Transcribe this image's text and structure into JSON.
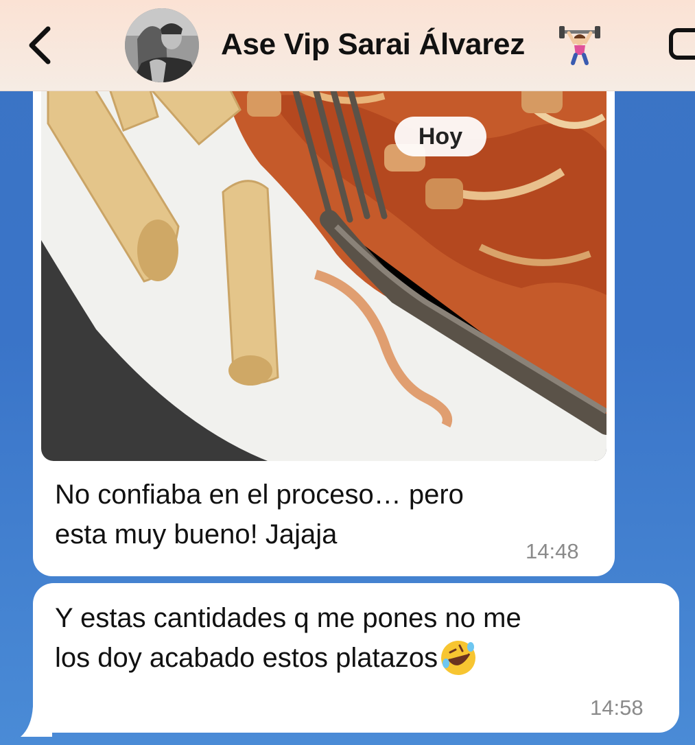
{
  "header": {
    "contact_name": "Ase Vip Sarai Álvarez",
    "status_emoji": "weightlifter-emoji",
    "back_icon": "chevron-left-icon",
    "avatar_icon": "contact-photo",
    "video_icon": "video-call-icon"
  },
  "date_separator": "Hoy",
  "messages": [
    {
      "type": "photo",
      "text": "No confiaba en el proceso… pero esta muy bueno! Jajaja",
      "line1": "No confiaba en el proceso… pero",
      "line2": "esta muy bueno! Jajaja",
      "time": "14:48"
    },
    {
      "type": "text",
      "line1": "Y estas cantidades q me pones no me",
      "line2": "los doy acabado estos platazos",
      "emoji": "rofl-emoji",
      "time": "14:58"
    }
  ],
  "colors": {
    "header_bg": "#f6ece4",
    "chat_bg": "#3b74c4",
    "bubble_bg": "#ffffff",
    "time_text": "#8a8a8a"
  }
}
